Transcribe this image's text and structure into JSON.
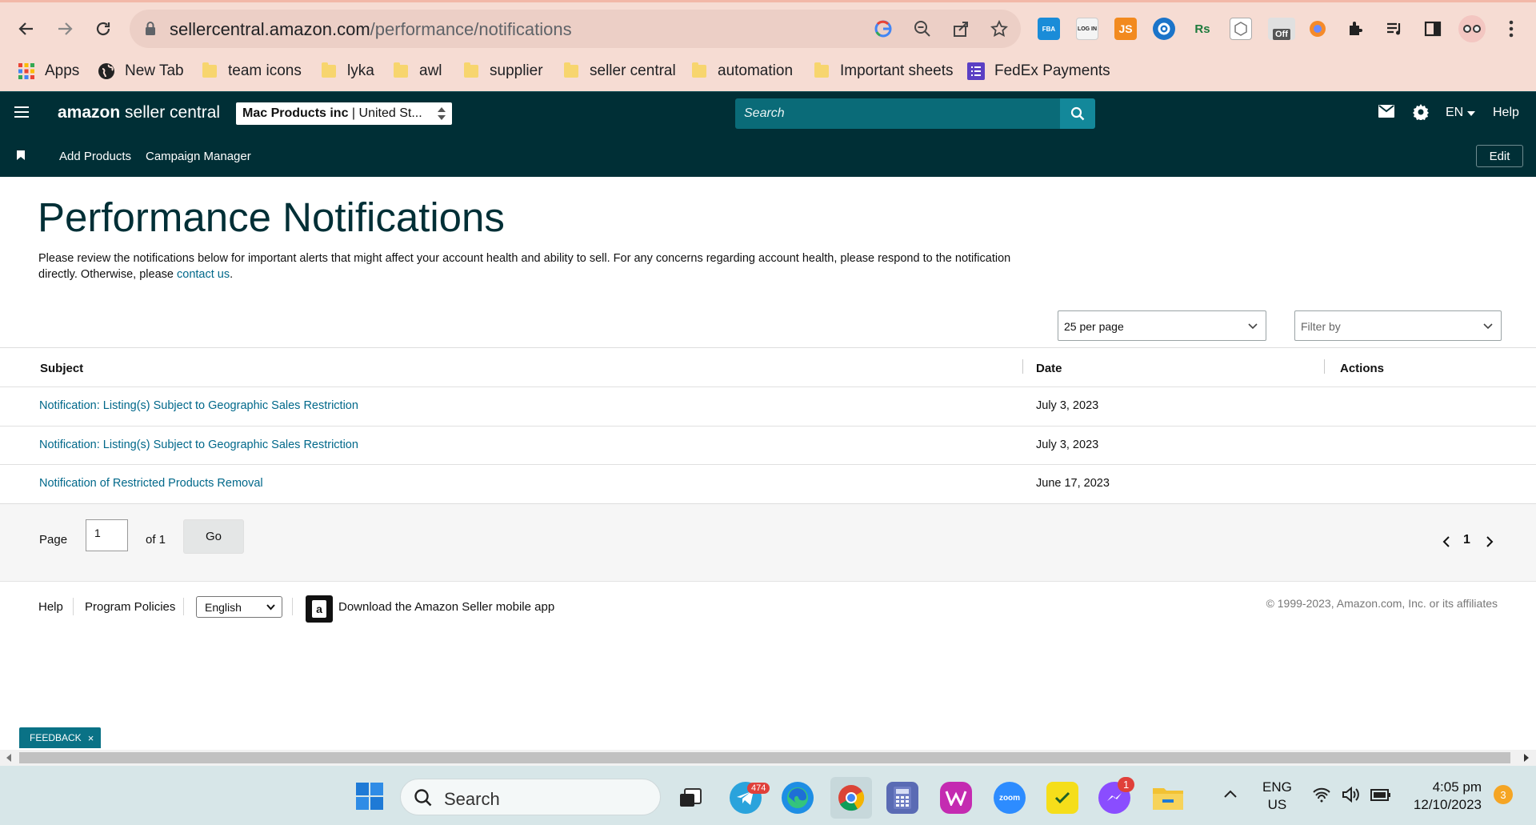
{
  "browser": {
    "url_domain": "sellercentral.amazon.com",
    "url_path": "/performance/notifications",
    "bookmarks": [
      {
        "label": "Apps",
        "icon": "apps-grid-icon"
      },
      {
        "label": "New Tab",
        "icon": "globe-icon"
      },
      {
        "label": "team icons",
        "icon": "folder-icon"
      },
      {
        "label": "lyka",
        "icon": "folder-icon"
      },
      {
        "label": "awl",
        "icon": "folder-icon"
      },
      {
        "label": "supplier",
        "icon": "folder-icon"
      },
      {
        "label": "seller central",
        "icon": "folder-icon"
      },
      {
        "label": "automation",
        "icon": "folder-icon"
      },
      {
        "label": "Important sheets",
        "icon": "folder-icon"
      },
      {
        "label": "FedEx Payments",
        "icon": "list-icon"
      }
    ],
    "extensions": {
      "fba": "FBA",
      "login": "LOG IN",
      "js": "JS",
      "rs": "Rs",
      "off_badge": "Off"
    }
  },
  "header": {
    "logo_brand": "amazon",
    "logo_product": " seller central",
    "account_name": "Mac Products inc",
    "account_region": " | United St...",
    "search_placeholder": "Search",
    "language": "EN",
    "help": "Help"
  },
  "subnav": {
    "links": [
      "Add Products",
      "Campaign Manager"
    ],
    "edit": "Edit"
  },
  "page": {
    "title": "Performance Notifications",
    "description": "Please review the notifications below for important alerts that might affect your account health and ability to sell. For any concerns regarding account health, please respond to the notification directly. Otherwise, please ",
    "contact_link": "contact us",
    "description_end": ".",
    "per_page": "25 per page",
    "filter_placeholder": "Filter by"
  },
  "table": {
    "columns": [
      "Subject",
      "Date",
      "Actions"
    ],
    "rows": [
      {
        "subject": "Notification: Listing(s) Subject to Geographic Sales Restriction",
        "date": "July 3, 2023"
      },
      {
        "subject": "Notification: Listing(s) Subject to Geographic Sales Restriction",
        "date": "July 3, 2023"
      },
      {
        "subject": "Notification of Restricted Products Removal",
        "date": "June 17, 2023"
      }
    ]
  },
  "pager": {
    "page_label": "Page",
    "page_value": "1",
    "of_label": "of 1",
    "go": "Go",
    "current_page": "1"
  },
  "footer": {
    "help": "Help",
    "policies": "Program Policies",
    "language": "English",
    "app_text": "Download the Amazon Seller mobile app",
    "copyright": "© 1999-2023, Amazon.com, Inc. or its affiliates"
  },
  "feedback": {
    "label": "FEEDBACK",
    "close": "×"
  },
  "taskbar": {
    "search": "Search",
    "telegram_badge": "474",
    "messenger_badge": "1",
    "zoom_label": "zoom",
    "lang_line1": "ENG",
    "lang_line2": "US",
    "time": "4:05 pm",
    "date": "12/10/2023",
    "notifications": "3"
  },
  "colors": {
    "header_bg": "#002f36",
    "link": "#00688a",
    "search_bg": "#0a6b78",
    "chrome_bg": "#f6dcd3",
    "feedback_bg": "#0a7286"
  }
}
